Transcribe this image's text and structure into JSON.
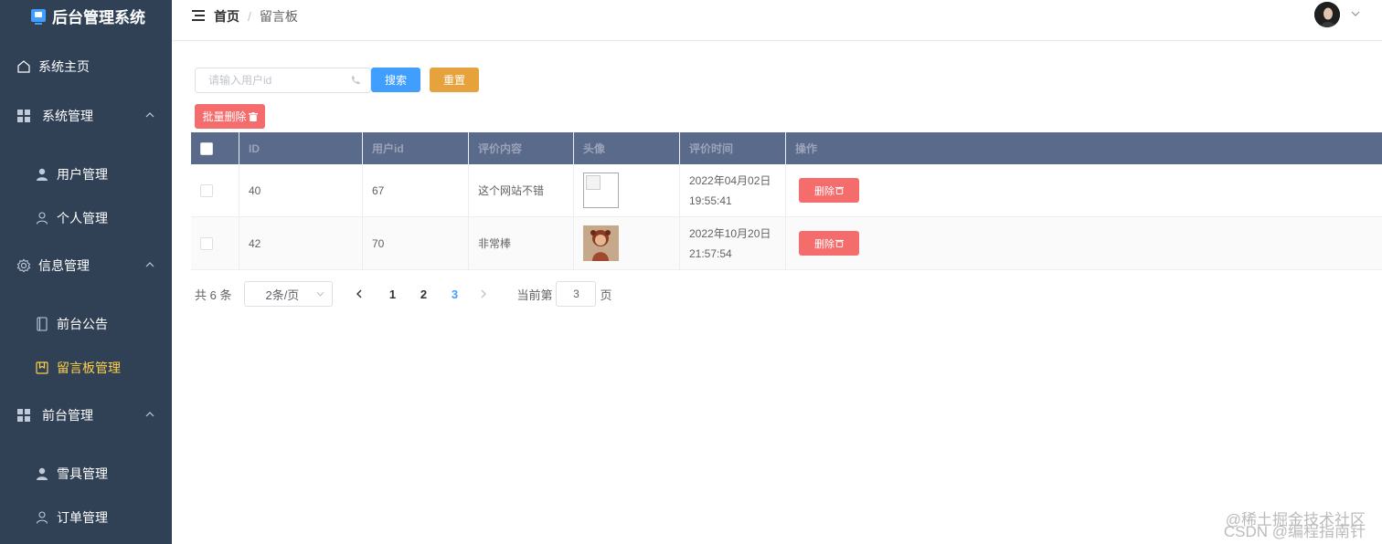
{
  "app": {
    "title": "后台管理系统",
    "accent": "#409EFF",
    "active_color": "#ffd04b",
    "sidebar_bg": "#304156"
  },
  "sidebar": {
    "home": "系统主页",
    "groups": [
      {
        "label": "系统管理",
        "icon": "grid-icon",
        "items": [
          {
            "label": "用户管理",
            "icon": "user-filled-icon"
          },
          {
            "label": "个人管理",
            "icon": "user-outline-icon"
          }
        ]
      },
      {
        "label": "信息管理",
        "icon": "gear-icon",
        "items": [
          {
            "label": "前台公告",
            "icon": "notebook-icon"
          },
          {
            "label": "留言板管理",
            "icon": "bookmark-icon",
            "active": true
          }
        ]
      },
      {
        "label": "前台管理",
        "icon": "grid-icon",
        "items": [
          {
            "label": "雪具管理",
            "icon": "user-filled-icon"
          },
          {
            "label": "订单管理",
            "icon": "user-outline-icon"
          }
        ]
      }
    ]
  },
  "header": {
    "breadcrumb": [
      "首页",
      "留言板"
    ],
    "separator": "/"
  },
  "toolbar": {
    "search_placeholder": "请输入用户id",
    "search_label": "搜索",
    "reset_label": "重置",
    "batch_delete_label": "批量删除"
  },
  "table": {
    "columns": [
      "ID",
      "用户id",
      "评价内容",
      "头像",
      "评价时间",
      "操作"
    ],
    "rows": [
      {
        "id": "40",
        "user_id": "67",
        "content": "这个网站不错",
        "avatar": "broken-image",
        "date": "2022年04月02日",
        "time": "19:55:41",
        "action": "删除"
      },
      {
        "id": "42",
        "user_id": "70",
        "content": "非常棒",
        "avatar": "photo",
        "date": "2022年10月20日",
        "time": "21:57:54",
        "action": "删除"
      }
    ]
  },
  "pagination": {
    "total_text": "共 6 条",
    "page_size": "2条/页",
    "pages": [
      "1",
      "2",
      "3"
    ],
    "current": "3",
    "goto_prefix": "当前第",
    "goto_value": "3",
    "goto_suffix": "页"
  },
  "watermark": [
    "@稀土掘金技术社区",
    "CSDN @编程指南针"
  ]
}
